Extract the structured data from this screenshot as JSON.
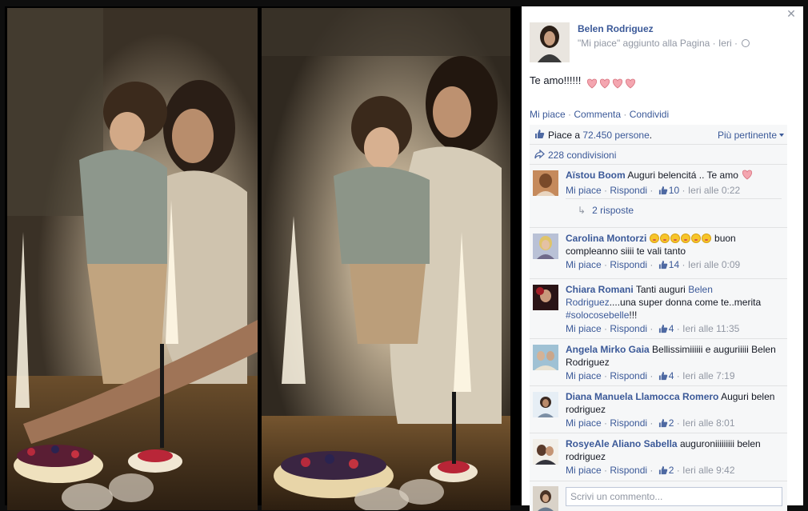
{
  "close_label": "✕",
  "post": {
    "author": "Belen Rodriguez",
    "meta": "\"Mi piace\" aggiunto alla Pagina · Ieri ·",
    "text": "Te amo!!!!!!",
    "heart_count": 4
  },
  "actions": {
    "like": "Mi piace",
    "comment": "Commenta",
    "share": "Condividi",
    "separator": "·"
  },
  "likes": {
    "prefix": "Piace a",
    "count": "72.450 persone",
    "suffix": ".",
    "sort": "Più pertinente"
  },
  "shares": {
    "text": "228 condivisioni"
  },
  "comment_ui": {
    "like": "Mi piace",
    "reply": "Rispondi",
    "sep": "·"
  },
  "comments": [
    {
      "name": "Aïstou Boom",
      "text": "Auguri belencitá .. Te amo",
      "likes": "10",
      "time": "Ieri alle 0:22",
      "replies": "2 risposte"
    },
    {
      "name": "Carolina Montorzi",
      "text": "buon compleanno siiii te vali tanto",
      "likes": "14",
      "time": "Ieri alle 0:09"
    },
    {
      "name": "Chiara Romani",
      "text_prefix": "Tanti auguri",
      "mention": "Belen Rodriguez",
      "text_middle": "....una super donna come te..merita",
      "hashtag": "#solocosebelle",
      "text_suffix": "!!!",
      "likes": "4",
      "time": "Ieri alle 11:35"
    },
    {
      "name": "Angela Mirko Gaia",
      "text": "Bellissimiiiiii e auguriiiii Belen Rodriguez",
      "likes": "4",
      "time": "Ieri alle 7:19"
    },
    {
      "name": "Diana Manuela Llamocca Romero",
      "text": "Auguri belen rodriguez",
      "likes": "2",
      "time": "Ieri alle 8:01"
    },
    {
      "name": "RosyeAle Aliano Sabella",
      "text": "auguroniiiiiiiii belen rodriguez",
      "likes": "2",
      "time": "Ieri alle 9:42"
    }
  ],
  "composer": {
    "placeholder": "Scrivi un commento..."
  },
  "colors": {
    "link": "#3b5998",
    "muted": "#9197a3",
    "ufi_bg": "#f6f7f8",
    "heart": "#f4a6b0"
  }
}
